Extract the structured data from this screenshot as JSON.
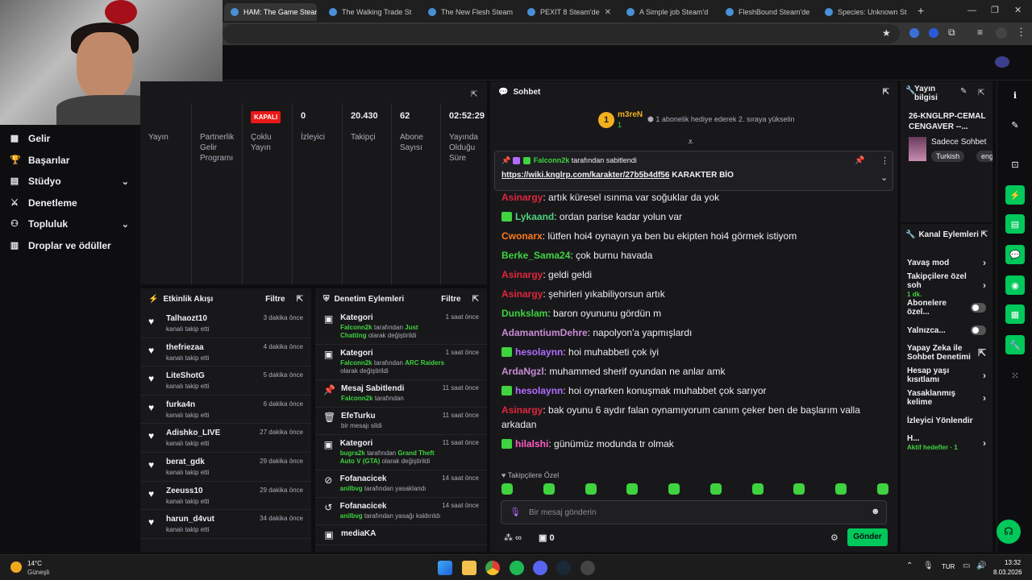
{
  "browser": {
    "tabs": [
      {
        "title": "HAM: The Game Steam",
        "active": true
      },
      {
        "title": "The Walking Trade St",
        "active": false
      },
      {
        "title": "The New Flesh Steam",
        "active": false
      },
      {
        "title": "PEXIT 8 Steam'de",
        "active": false
      },
      {
        "title": "A Simple job Steam'd",
        "active": false
      },
      {
        "title": "FleshBound Steam'de",
        "active": false
      },
      {
        "title": "Species: Unknown St",
        "active": false
      }
    ],
    "new_tab": "+"
  },
  "leftnav": {
    "items": [
      {
        "label": "Gelir",
        "icon": "bar-chart-icon",
        "expand": false
      },
      {
        "label": "Başarılar",
        "icon": "trophy-icon",
        "expand": false
      },
      {
        "label": "Stüdyo",
        "icon": "studio-icon",
        "expand": true
      },
      {
        "label": "Denetleme",
        "icon": "sword-icon",
        "expand": false
      },
      {
        "label": "Topluluk",
        "icon": "community-icon",
        "expand": true
      },
      {
        "label": "Droplar ve ödüller",
        "icon": "gift-icon",
        "expand": false
      }
    ]
  },
  "stats": [
    {
      "value": "",
      "label": "Yayın"
    },
    {
      "value": "",
      "label": "Partnerlik Gelir Programı"
    },
    {
      "value": "KAPALI",
      "label": "Çoklu Yayın"
    },
    {
      "value": "0",
      "label": "İzleyici"
    },
    {
      "value": "20.430",
      "label": "Takipçi"
    },
    {
      "value": "62",
      "label": "Abone Sayısı"
    },
    {
      "value": "02:52:29",
      "label": "Yayında Olduğu Süre"
    }
  ],
  "activity": {
    "title": "Etkinlik Akışı",
    "filter": "Filtre",
    "items": [
      {
        "name": "Talhaozt10",
        "desc": "kanalı takip etti",
        "time": "3 dakika önce"
      },
      {
        "name": "thefriezaa",
        "desc": "kanalı takip etti",
        "time": "4 dakika önce"
      },
      {
        "name": "LiteShotG",
        "desc": "kanalı takip etti",
        "time": "5 dakika önce"
      },
      {
        "name": "furka4n",
        "desc": "kanalı takip etti",
        "time": "6 dakika önce"
      },
      {
        "name": "Adishko_LIVE",
        "desc": "kanalı takip etti",
        "time": "27 dakika önce"
      },
      {
        "name": "berat_gdk",
        "desc": "kanalı takip etti",
        "time": "29 dakika önce"
      },
      {
        "name": "Zeeuss10",
        "desc": "kanalı takip etti",
        "time": "29 dakika önce"
      },
      {
        "name": "harun_d4vut",
        "desc": "kanalı takip etti",
        "time": "34 dakika önce"
      }
    ]
  },
  "modactions": {
    "title": "Denetim Eylemleri",
    "filter": "Filtre",
    "items": [
      {
        "title": "Kategori",
        "icon": "category-icon",
        "by": "Falconn2k",
        "mid": "tarafından",
        "target": "Just Chatting",
        "rest": "olarak değiştirildi",
        "time": "1 saat önce"
      },
      {
        "title": "Kategori",
        "icon": "category-icon",
        "by": "Falconn2k",
        "mid": "tarafından",
        "target": "ARC Raiders",
        "rest": "olarak değiştirildi",
        "time": "1 saat önce"
      },
      {
        "title": "Mesaj Sabitlendi",
        "icon": "pin-icon",
        "by": "Falconn2k",
        "mid": "tarafından",
        "target": "",
        "rest": "",
        "time": "11 saat önce"
      },
      {
        "title": "EfeTurku",
        "icon": "trash-icon",
        "by": "",
        "mid": "bir mesajı sildi",
        "target": "",
        "rest": "",
        "time": "11 saat önce"
      },
      {
        "title": "Kategori",
        "icon": "category-icon",
        "by": "bugra2k",
        "mid": "tarafından",
        "target": "Grand Theft Auto V (GTA)",
        "rest": "olarak değiştirildi",
        "time": "11 saat önce"
      },
      {
        "title": "Fofanacicek",
        "icon": "ban-icon",
        "by": "anilbvg",
        "mid": "tarafından yasaklandı",
        "target": "",
        "rest": "",
        "time": "14 saat önce"
      },
      {
        "title": "Fofanacicek",
        "icon": "undo-icon",
        "by": "anilbvg",
        "mid": "tarafından yasağı kaldırıldı",
        "target": "",
        "rest": "",
        "time": "14 saat önce"
      },
      {
        "title": "mediaKA",
        "icon": "category-icon",
        "by": "",
        "mid": "",
        "target": "",
        "rest": "",
        "time": ""
      }
    ]
  },
  "chat": {
    "title": "Sohbet",
    "leader": {
      "rank": "1",
      "name": "m3reN",
      "count": "1",
      "note": "1 abonelik hediye ederek 2. sıraya yükselin"
    },
    "pinned": {
      "by": "Falconn2k",
      "by_suffix": "tarafından sabitlendi",
      "link": "https://wiki.knglrp.com/karakter/27b5b4df56",
      "text": "KARAKTER BİO"
    },
    "messages": [
      {
        "user": "Asinargy",
        "color": "#e0263d",
        "badge": false,
        "text": "artık küresel ısınma var soğuklar da yok"
      },
      {
        "user": "Lykaand",
        "color": "#4fd17a",
        "badge": true,
        "text": "ordan parise kadar yolun var"
      },
      {
        "user": "Cwonarx",
        "color": "#ff7a1a",
        "badge": false,
        "text": "lütfen hoi4 oynayın ya ben bu ekipten hoi4 görmek istiyom"
      },
      {
        "user": "Berke_Sama24",
        "color": "#3fd33f",
        "badge": false,
        "text": "çok burnu havada"
      },
      {
        "user": "Asinargy",
        "color": "#e0263d",
        "badge": false,
        "text": "geldi geldi"
      },
      {
        "user": "Asinargy",
        "color": "#e0263d",
        "badge": false,
        "text": "şehirleri yıkabiliyorsun artık"
      },
      {
        "user": "Dunkslam",
        "color": "#3fd33f",
        "badge": false,
        "text": "baron oyununu gördün m"
      },
      {
        "user": "AdamantiumDehre",
        "color": "#c88bd4",
        "badge": false,
        "text": "napolyon'a yapmışlardı"
      },
      {
        "user": "hesolaynn",
        "color": "#b36bff",
        "badge": true,
        "text": "hoi muhabbeti çok iyi"
      },
      {
        "user": "ArdaNgzl",
        "color": "#c88bd4",
        "badge": false,
        "text": "muhammed sherif oyundan ne anlar amk"
      },
      {
        "user": "hesolaynn",
        "color": "#b36bff",
        "badge": true,
        "text": "hoi oynarken konuşmak muhabbet çok sarıyor"
      },
      {
        "user": "Asinargy",
        "color": "#e0263d",
        "badge": false,
        "text": "bak oyunu 6 aydır falan oynamıyorum canım çeker ben de başlarım valla arkadan"
      },
      {
        "user": "hilalshi",
        "color": "#ff5ec4",
        "badge": true,
        "text": "günümüz modunda tr olmak"
      }
    ],
    "followers_only": "Takipçilere Özel",
    "input_placeholder": "Bir mesaj gönderin",
    "points": "∞",
    "points_count": "0",
    "send": "Gönder"
  },
  "streaminfo": {
    "title": "Yayın bilgisi",
    "stream_title": "26-KNGLRP-CEMAL CENGAVER --...",
    "category": "Sadece Sohbet",
    "tags": [
      "Turkish",
      "eng"
    ]
  },
  "channelactions": {
    "title": "Kanal Eylemleri",
    "items": [
      {
        "label": "Yavaş mod",
        "kind": "chevron",
        "sub": ""
      },
      {
        "label": "Takipçilere özel soh",
        "kind": "chevron",
        "sub": "1 dk."
      },
      {
        "label": "Abonelere özel...",
        "kind": "toggle",
        "sub": ""
      },
      {
        "label": "Yalnızca...",
        "kind": "toggle",
        "sub": ""
      },
      {
        "label": "Yapay Zeka ile Sohbet Denetimi",
        "kind": "popout",
        "sub": ""
      },
      {
        "label": "Hesap yaşı kısıtlamı",
        "kind": "chevron",
        "sub": ""
      },
      {
        "label": "Yasaklanmış kelime",
        "kind": "chevron",
        "sub": ""
      },
      {
        "label": "İzleyici Yönlendir",
        "kind": "none",
        "sub": ""
      },
      {
        "label": "H...",
        "kind": "chevron",
        "sub": "Aktif hedefler · 1"
      }
    ]
  },
  "taskbar": {
    "weather_temp": "14°C",
    "weather_desc": "Güneşli",
    "lang": "TUR",
    "time": "13:32",
    "date": "8.03.2026"
  },
  "colors": {
    "accent": "#00c85a",
    "panel": "#18181b",
    "bg": "#0e0e10",
    "link": "#3fd33f"
  }
}
